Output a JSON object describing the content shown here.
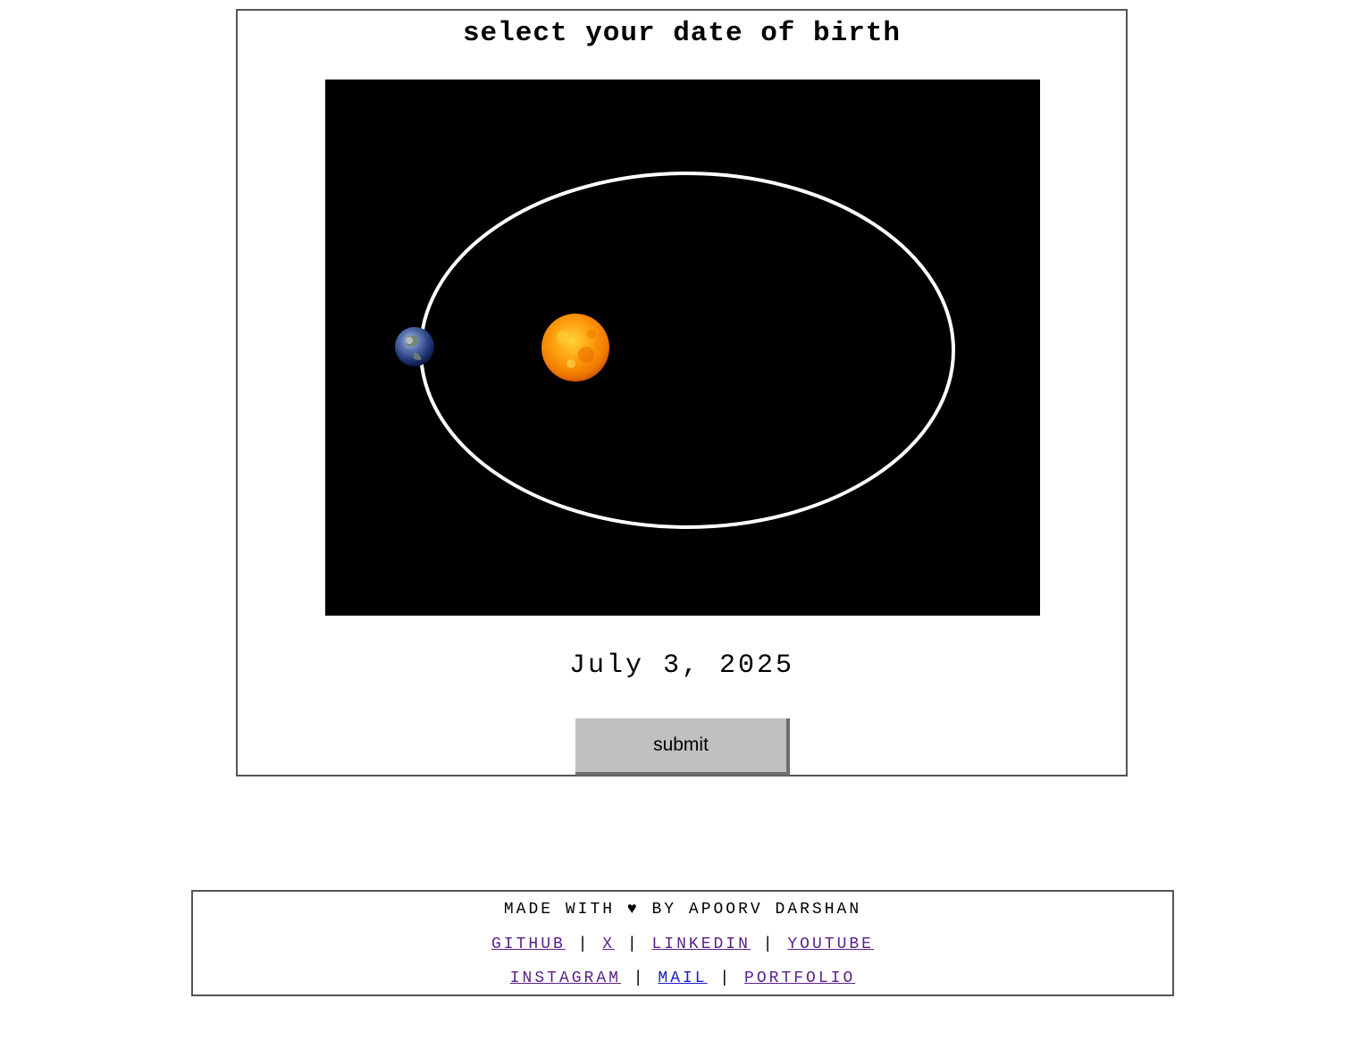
{
  "title": "select your date of birth",
  "selected_date": "July 3, 2025",
  "submit_label": "submit",
  "footer": {
    "credit_prefix": "MADE WITH",
    "heart": "♥",
    "credit_suffix": "BY APOORV DARSHAN",
    "separator": "|",
    "links_row1": [
      "GITHUB",
      "X",
      "LINKEDIN",
      "YOUTUBE"
    ],
    "links_row2": [
      "INSTAGRAM",
      "MAIL",
      "PORTFOLIO"
    ]
  },
  "colors": {
    "canvas_background": "#000000",
    "orbit": "#ffffff",
    "visited_link": "#5a1f8a",
    "link": "#1a1acc",
    "button": "#c0c0c0"
  },
  "icons": [
    "earth-icon",
    "sun-icon"
  ]
}
